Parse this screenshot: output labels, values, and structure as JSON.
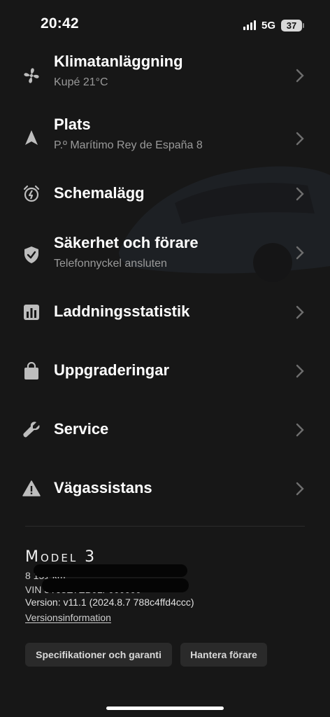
{
  "status": {
    "time": "20:42",
    "network": "5G",
    "battery": "37"
  },
  "menu": [
    {
      "title": "Klimatanläggning",
      "subtitle": "Kupé 21°C",
      "icon": "fan-icon"
    },
    {
      "title": "Plats",
      "subtitle": "P.º Marítimo Rey de España 8",
      "icon": "location-arrow-icon"
    },
    {
      "title": "Schemalägg",
      "subtitle": "",
      "icon": "alarm-clock-icon"
    },
    {
      "title": "Säkerhet och förare",
      "subtitle": "Telefonnyckel ansluten",
      "icon": "shield-check-icon"
    },
    {
      "title": "Laddningsstatistik",
      "subtitle": "",
      "icon": "bar-chart-icon"
    },
    {
      "title": "Uppgraderingar",
      "subtitle": "",
      "icon": "shopping-bag-icon"
    },
    {
      "title": "Service",
      "subtitle": "",
      "icon": "wrench-icon"
    },
    {
      "title": "Vägassistans",
      "subtitle": "",
      "icon": "warning-triangle-icon"
    }
  ],
  "vehicle": {
    "model": "Model 3",
    "odometer": "8 151 km",
    "vin": "VIN 5YJ3E7EB0LF000000",
    "version": "Version: v11.1 (2024.8.7 788c4ffd4ccc)",
    "version_link": "Versionsinformation"
  },
  "buttons": {
    "specs": "Specifikationer och garanti",
    "drivers": "Hantera förare"
  }
}
